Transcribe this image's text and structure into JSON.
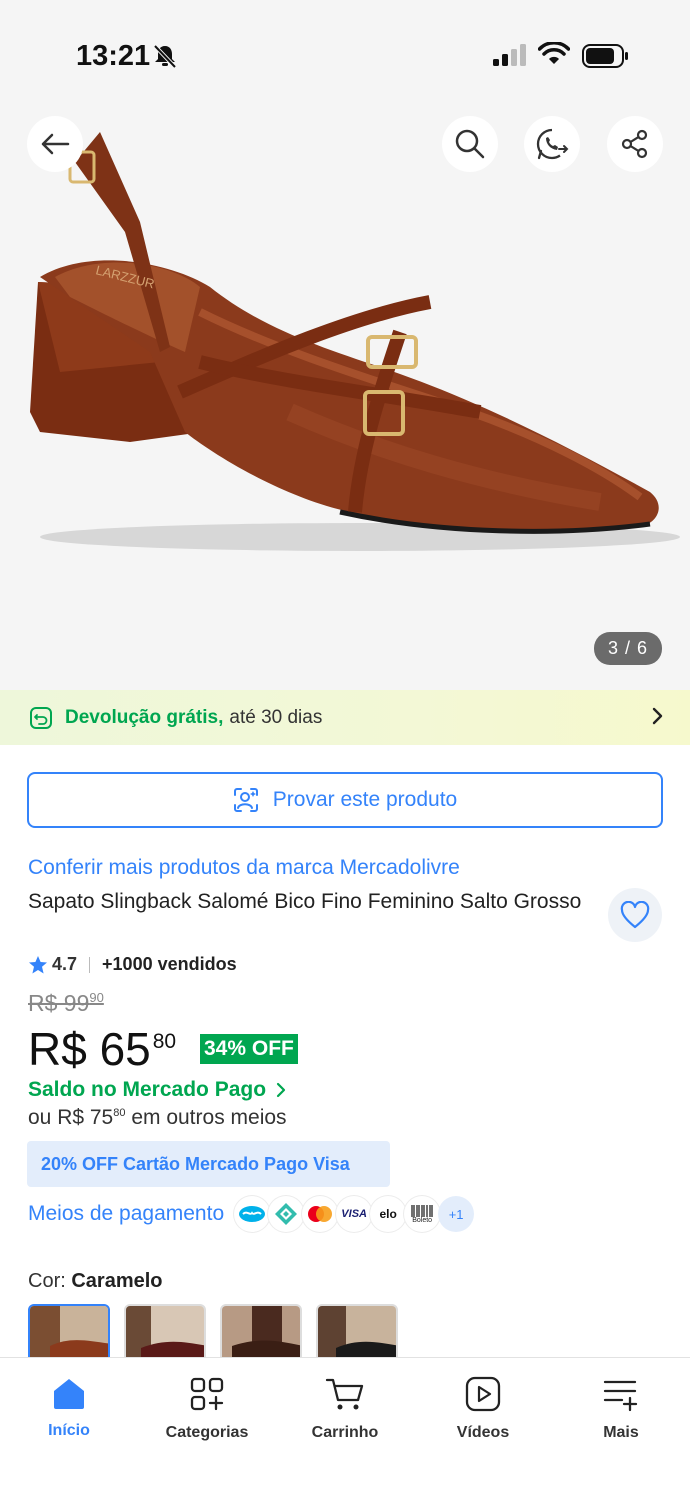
{
  "status_bar": {
    "time": "13:21"
  },
  "hero": {
    "image_counter": "3 / 6",
    "brand_on_insole": "LARZZUR"
  },
  "returns_banner": {
    "strong": "Devolução grátis,",
    "text": "até 30 dias"
  },
  "try_button": {
    "label": "Provar este produto"
  },
  "product": {
    "brand_link": "Conferir mais produtos da marca Mercadolivre",
    "title": "Sapato Slingback Salomé Bico Fino Feminino Salto Grosso",
    "rating": "4.7",
    "sold": "+1000 vendidos",
    "old_price_main": "R$ 99",
    "old_price_cents": "90",
    "price_main": "R$ 65",
    "price_cents": "80",
    "discount": "34% OFF",
    "saldo": "Saldo no Mercado Pago",
    "other_prefix": "ou R$ 75",
    "other_cents": "80",
    "other_suffix": " em outros meios",
    "promo": "20% OFF Cartão Mercado Pago Visa",
    "payment_label": "Meios de pagamento",
    "payment_more": "+1",
    "payment_visa": "VISA",
    "payment_elo": "elo",
    "payment_boleto": "Boleto",
    "color_prefix": "Cor:",
    "color_value": "Caramelo"
  },
  "colors": {
    "accent": "#3483fa",
    "green": "#00a650",
    "shoe": "#8b3a1c"
  },
  "nav": {
    "items": [
      {
        "label": "Início"
      },
      {
        "label": "Categorias"
      },
      {
        "label": "Carrinho"
      },
      {
        "label": "Vídeos"
      },
      {
        "label": "Mais"
      }
    ]
  }
}
